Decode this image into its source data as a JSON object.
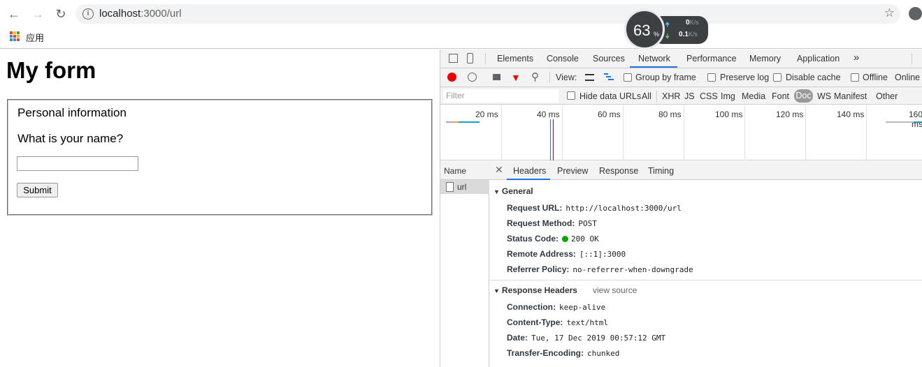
{
  "browser": {
    "url_host": "localhost",
    "url_path": ":3000/url",
    "bookmarks_label": "应用"
  },
  "speed_widget": {
    "percent": "63",
    "percent_sign": "%",
    "upload_value": "0",
    "upload_unit": "K/s",
    "download_value": "0.1",
    "download_unit": "K/s"
  },
  "page": {
    "title": "My form",
    "legend": "Personal information",
    "question": "What is your name?",
    "name_value": "",
    "submit_label": "Submit"
  },
  "devtools": {
    "tabs": [
      "Elements",
      "Console",
      "Sources",
      "Network",
      "Performance",
      "Memory",
      "Application"
    ],
    "active_tab": "Network",
    "more_tabs": "»",
    "toolbar": {
      "view_label": "View:",
      "group_by_frame": "Group by frame",
      "preserve_log": "Preserve log",
      "disable_cache": "Disable cache",
      "offline": "Offline",
      "online": "Online"
    },
    "filter": {
      "placeholder": "Filter",
      "hide_data_urls": "Hide data URLs",
      "types": [
        "All",
        "XHR",
        "JS",
        "CSS",
        "Img",
        "Media",
        "Font",
        "Doc",
        "WS",
        "Manifest",
        "Other"
      ],
      "active_type": "Doc"
    },
    "overview_ticks": [
      "20 ms",
      "40 ms",
      "60 ms",
      "80 ms",
      "100 ms",
      "120 ms",
      "140 ms",
      "160 ms"
    ],
    "requests": {
      "column_name": "Name",
      "items": [
        "url"
      ]
    },
    "detail": {
      "tabs": [
        "Headers",
        "Preview",
        "Response",
        "Timing"
      ],
      "active_tab": "Headers",
      "general_title": "General",
      "general": [
        {
          "key": "Request URL:",
          "value": "http://localhost:3000/url"
        },
        {
          "key": "Request Method:",
          "value": "POST"
        },
        {
          "key": "Status Code:",
          "value": "200 OK"
        },
        {
          "key": "Remote Address:",
          "value": "[::1]:3000"
        },
        {
          "key": "Referrer Policy:",
          "value": "no-referrer-when-downgrade"
        }
      ],
      "response_title": "Response Headers",
      "view_source": "view source",
      "response_headers": [
        {
          "key": "Connection:",
          "value": "keep-alive"
        },
        {
          "key": "Content-Type:",
          "value": "text/html"
        },
        {
          "key": "Date:",
          "value": "Tue, 17 Dec 2019 00:57:12 GMT"
        },
        {
          "key": "Transfer-Encoding:",
          "value": "chunked"
        }
      ]
    }
  },
  "colors": {
    "accent": "#1a73e8",
    "record": "#e00000",
    "status_ok": "#00aa00"
  }
}
